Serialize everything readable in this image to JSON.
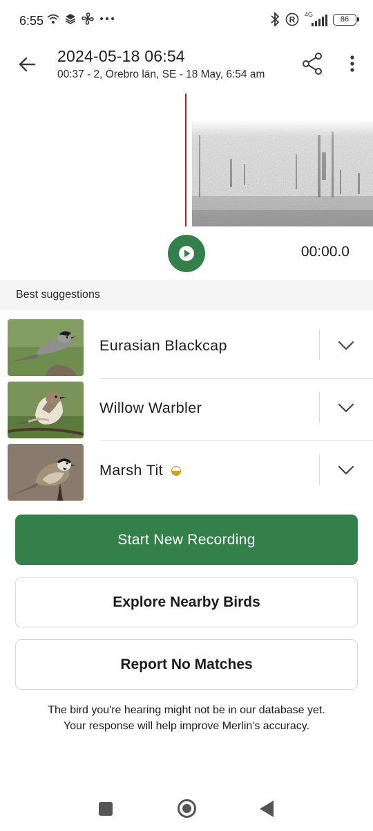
{
  "status_bar": {
    "time": "6:55",
    "left_icons": [
      "wifi-icon",
      "layers-icon",
      "fan-icon",
      "more-dots-icon"
    ],
    "right_icons": [
      "bluetooth-icon",
      "registered-icon",
      "signal-4g-icon"
    ],
    "network": "4G",
    "battery": "86"
  },
  "app_bar": {
    "title": "2024-05-18 06:54",
    "subtitle": "00:37 - 2, Örebro län, SE - 18 May, 6:54 am"
  },
  "player": {
    "time": "00:00.0"
  },
  "suggestions": {
    "header": "Best suggestions",
    "items": [
      {
        "name": "Eurasian Blackcap"
      },
      {
        "name": "Willow Warbler"
      },
      {
        "name": "Marsh Tit",
        "badge": "half-filled-circle-icon"
      }
    ]
  },
  "actions": {
    "start_recording": "Start New Recording",
    "explore": "Explore Nearby Birds",
    "report": "Report No Matches"
  },
  "footer": {
    "line1": "The bird you're hearing might not be in our database yet.",
    "line2": "Your response will help improve Merlin's accuracy."
  },
  "colors": {
    "primary": "#34804a",
    "playhead": "#b01e1e",
    "badge": "#d9a213"
  }
}
